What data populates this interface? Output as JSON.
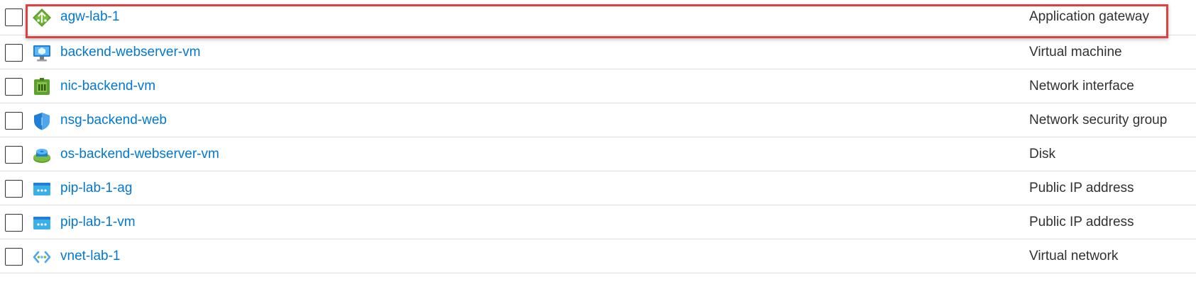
{
  "resources": [
    {
      "name": "agw-lab-1",
      "type": "Application gateway",
      "icon": "application-gateway-icon"
    },
    {
      "name": "backend-webserver-vm",
      "type": "Virtual machine",
      "icon": "virtual-machine-icon"
    },
    {
      "name": "nic-backend-vm",
      "type": "Network interface",
      "icon": "network-interface-icon"
    },
    {
      "name": "nsg-backend-web",
      "type": "Network security group",
      "icon": "network-security-group-icon"
    },
    {
      "name": "os-backend-webserver-vm",
      "type": "Disk",
      "icon": "disk-icon"
    },
    {
      "name": "pip-lab-1-ag",
      "type": "Public IP address",
      "icon": "public-ip-icon"
    },
    {
      "name": "pip-lab-1-vm",
      "type": "Public IP address",
      "icon": "public-ip-icon"
    },
    {
      "name": "vnet-lab-1",
      "type": "Virtual network",
      "icon": "virtual-network-icon"
    }
  ],
  "highlight": {
    "row": 0,
    "color": "#e0403f"
  },
  "colors": {
    "link": "#0078d4",
    "text": "#323130",
    "divider": "#e1dfdd"
  }
}
